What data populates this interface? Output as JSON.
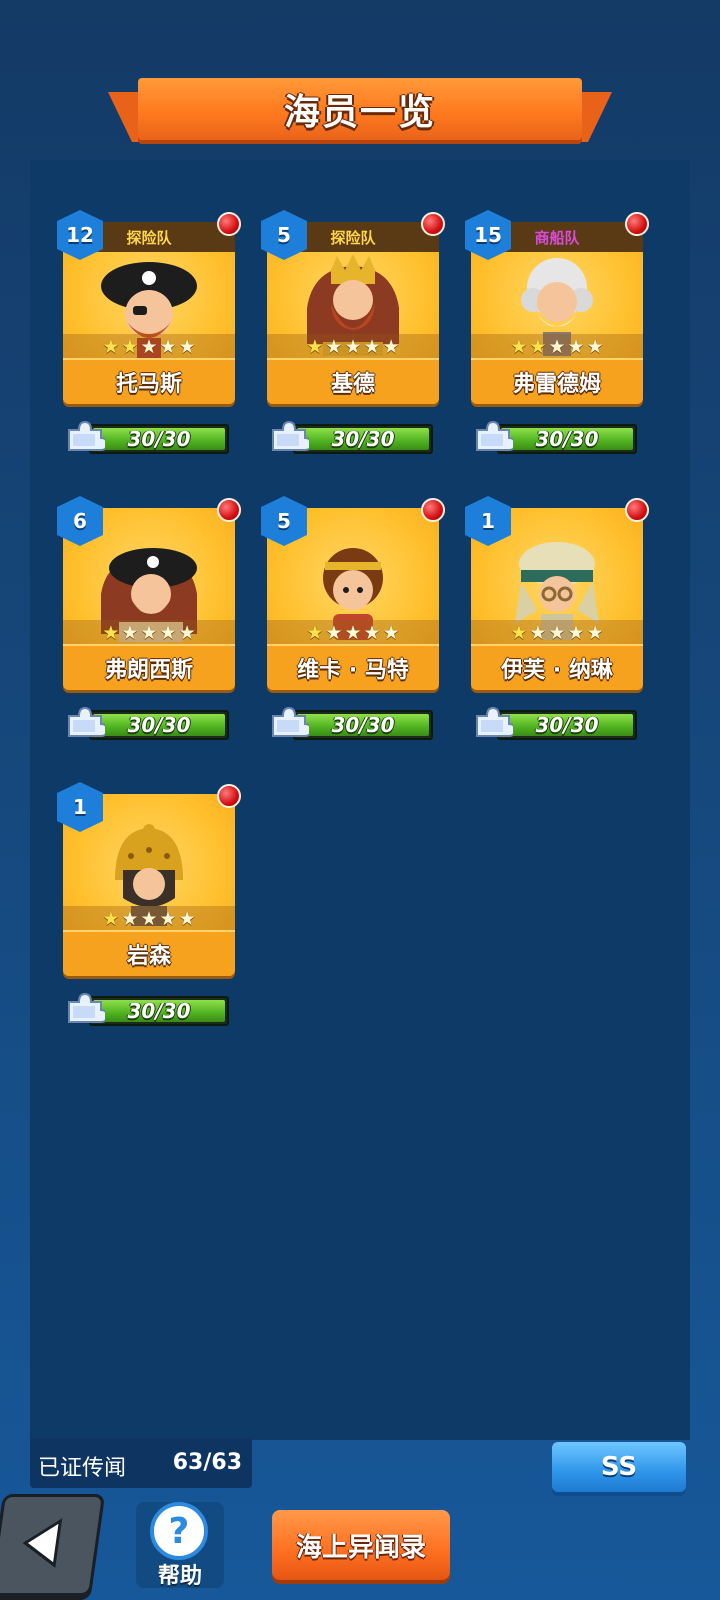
{
  "header": {
    "title": "海员一览"
  },
  "crew": [
    {
      "level": "12",
      "team": "探险队",
      "team_type": "explore",
      "name": "托马斯",
      "stars": 2,
      "max_stars": 5,
      "fragments": "30/30",
      "portrait": "pirate-captain",
      "notify": true
    },
    {
      "level": "5",
      "team": "探险队",
      "team_type": "explore",
      "name": "基德",
      "stars": 1,
      "max_stars": 5,
      "fragments": "30/30",
      "portrait": "bearded-king",
      "notify": true
    },
    {
      "level": "15",
      "team": "商船队",
      "team_type": "merchant",
      "name": "弗雷德姆",
      "stars": 2,
      "max_stars": 5,
      "fragments": "30/30",
      "portrait": "old-scholar",
      "notify": true
    },
    {
      "level": "6",
      "team": "",
      "team_type": "",
      "name": "弗朗西斯",
      "stars": 1,
      "max_stars": 5,
      "fragments": "30/30",
      "portrait": "pirate-bearded",
      "notify": true
    },
    {
      "level": "5",
      "team": "",
      "team_type": "",
      "name": "维卡 · 马特",
      "stars": 1,
      "max_stars": 5,
      "fragments": "30/30",
      "portrait": "warrior",
      "notify": true
    },
    {
      "level": "1",
      "team": "",
      "team_type": "",
      "name": "伊芙 · 纳琳",
      "stars": 1,
      "max_stars": 5,
      "fragments": "30/30",
      "portrait": "desert-explorer",
      "notify": true
    },
    {
      "level": "1",
      "team": "",
      "team_type": "",
      "name": "岩森",
      "stars": 1,
      "max_stars": 5,
      "fragments": "30/30",
      "portrait": "helmet-soldier",
      "notify": true
    }
  ],
  "footer": {
    "proven_label": "已证传闻",
    "proven_value": "63/63",
    "ss_label": "SS",
    "help_label": "帮助",
    "help_icon": "?",
    "log_label": "海上异闻录",
    "back_icon": "arrow-left-icon"
  },
  "colors": {
    "accent": "#ff7a1e",
    "panel": "#0e3a68",
    "card": "#ffbf2c",
    "fragment_bar": "#4fb220",
    "merchant_team": "#d94bd9",
    "explore_team": "#ffd54a"
  }
}
